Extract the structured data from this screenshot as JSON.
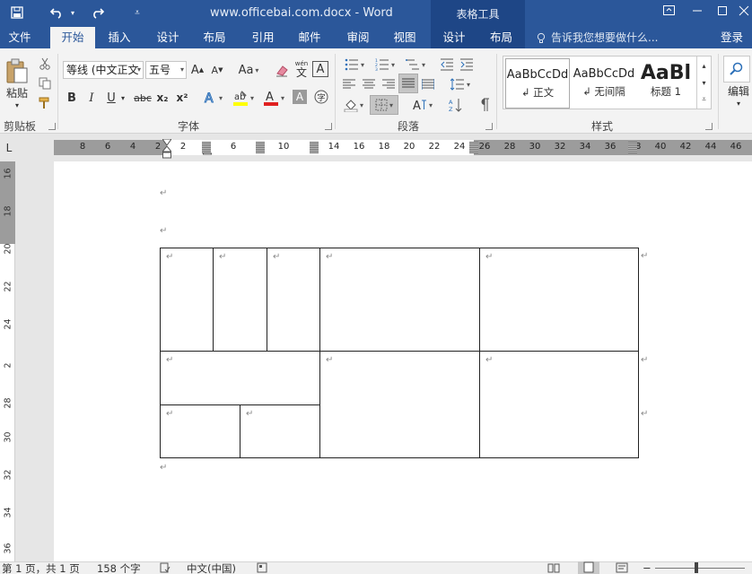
{
  "titlebar": {
    "doc_title": "www.officebai.com.docx - Word",
    "context_tools": "表格工具",
    "brand_color": "#2b579a"
  },
  "tabs": [
    {
      "label": "文件"
    },
    {
      "label": "开始"
    },
    {
      "label": "插入"
    },
    {
      "label": "设计"
    },
    {
      "label": "布局"
    },
    {
      "label": "引用"
    },
    {
      "label": "邮件"
    },
    {
      "label": "审阅"
    },
    {
      "label": "视图"
    },
    {
      "label": "设计"
    },
    {
      "label": "布局"
    }
  ],
  "tell_me": "告诉我您想要做什么...",
  "login": "登录",
  "ribbon": {
    "clipboard": {
      "paste_label": "粘贴",
      "group_label": "剪贴板"
    },
    "font": {
      "font_name": "等线 (中文正文",
      "font_size": "五号",
      "case_label": "Aa",
      "wen_label": "wén",
      "bold": "B",
      "italic": "I",
      "underline": "U",
      "strike": "abc",
      "sub": "x₂",
      "sup": "x²",
      "group_label": "字体"
    },
    "paragraph": {
      "group_label": "段落"
    },
    "styles": {
      "items": [
        {
          "preview": "AaBbCcDd",
          "name": "↲ 正文"
        },
        {
          "preview": "AaBbCcDd",
          "name": "↲ 无间隔"
        },
        {
          "preview": "AaBl",
          "name": "标题 1"
        }
      ],
      "group_label": "样式"
    },
    "editing": {
      "label": "编辑"
    }
  },
  "ruler": {
    "corner": "L",
    "numbers": [
      "8",
      "6",
      "4",
      "2",
      "2",
      "6",
      "10",
      "14",
      "16",
      "18",
      "20",
      "22",
      "24",
      "26",
      "28",
      "30",
      "32",
      "34",
      "36",
      "38",
      "40",
      "42",
      "44",
      "46"
    ]
  },
  "vruler": {
    "numbers": [
      "16",
      "18",
      "20",
      "22",
      "24",
      "2",
      "28",
      "30",
      "32",
      "34",
      "36"
    ]
  },
  "document": {
    "para_mark": "↵"
  },
  "statusbar": {
    "page": "第 1 页，共 1 页",
    "words": "158 个字",
    "language": "中文(中国)"
  }
}
